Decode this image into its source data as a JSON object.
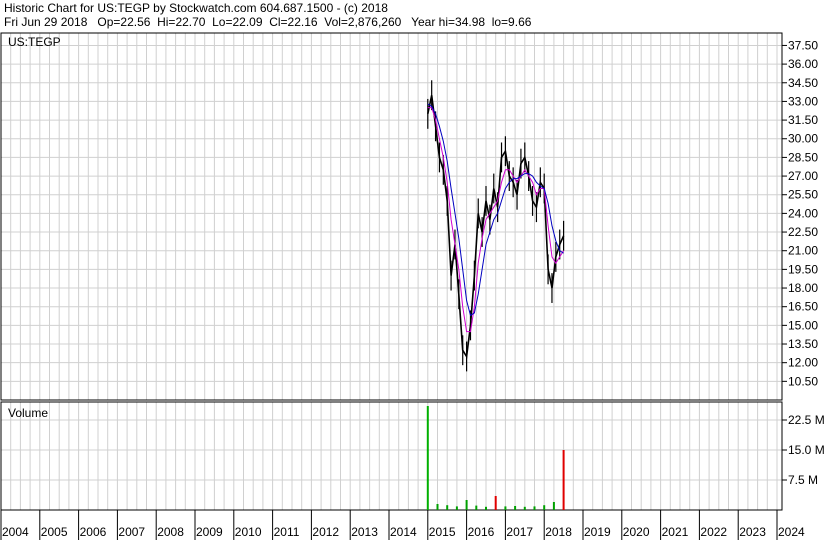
{
  "header": {
    "title_line": "Historic Chart for US:TEGP by Stockwatch.com 604.687.1500 - (c) 2018",
    "quote_line": "Fri Jun 29 2018   Op=22.56  Hi=22.70  Lo=22.09  Cl=22.16  Vol=2,876,260   Year hi=34.98  lo=9.66"
  },
  "price_panel": {
    "symbol_label": "US:TEGP"
  },
  "volume_panel": {
    "title": "Volume"
  },
  "chart_data": [
    {
      "type": "line",
      "title": "US:TEGP",
      "ylim": [
        9,
        38.5
      ],
      "yticks": [
        "37.50",
        "36.00",
        "34.50",
        "33.00",
        "31.50",
        "30.00",
        "28.50",
        "27.00",
        "25.50",
        "24.00",
        "22.50",
        "21.00",
        "19.50",
        "18.00",
        "16.50",
        "15.00",
        "13.50",
        "12.00",
        "10.50"
      ],
      "x": [
        "2015.0",
        "2015.1",
        "2015.2",
        "2015.3",
        "2015.4",
        "2015.5",
        "2015.6",
        "2015.7",
        "2015.8",
        "2015.9",
        "2016.0",
        "2016.1",
        "2016.2",
        "2016.3",
        "2016.4",
        "2016.5",
        "2016.6",
        "2016.7",
        "2016.8",
        "2016.9",
        "2017.0",
        "2017.1",
        "2017.2",
        "2017.3",
        "2017.4",
        "2017.5",
        "2017.6",
        "2017.7",
        "2017.8",
        "2017.9",
        "2018.0",
        "2018.1",
        "2018.2",
        "2018.3",
        "2018.4",
        "2018.5"
      ],
      "series": [
        {
          "values": [
            32.0,
            33.5,
            31.0,
            28.5,
            27.5,
            25.0,
            19.0,
            21.5,
            17.5,
            13.0,
            12.5,
            15.0,
            19.0,
            24.0,
            22.5,
            25.0,
            23.5,
            26.0,
            24.5,
            28.5,
            29.0,
            27.0,
            26.5,
            25.5,
            28.0,
            28.5,
            27.0,
            25.0,
            24.5,
            26.5,
            26.0,
            19.5,
            18.0,
            20.5,
            21.5,
            22.2
          ]
        },
        {
          "values": [
            32.5,
            32.5,
            31.5,
            30.0,
            28.5,
            26.5,
            23.5,
            21.5,
            19.5,
            16.5,
            14.5,
            14.5,
            16.5,
            20.0,
            22.0,
            23.5,
            24.0,
            24.5,
            25.0,
            26.5,
            27.5,
            27.5,
            27.0,
            26.5,
            27.0,
            27.5,
            27.0,
            26.5,
            25.5,
            26.0,
            26.0,
            23.0,
            20.5,
            20.0,
            20.5,
            21.0
          ]
        },
        {
          "values": [
            32.8,
            32.6,
            32.0,
            31.0,
            29.8,
            28.2,
            26.0,
            24.0,
            22.0,
            19.5,
            17.0,
            15.8,
            16.0,
            17.5,
            19.5,
            21.5,
            22.5,
            23.5,
            24.0,
            25.0,
            26.0,
            26.5,
            26.8,
            26.8,
            27.0,
            27.2,
            27.2,
            27.0,
            26.5,
            26.2,
            26.0,
            24.8,
            23.0,
            21.8,
            21.0,
            20.8
          ]
        }
      ]
    },
    {
      "type": "bar",
      "title": "Volume",
      "ylim": [
        0,
        27000000
      ],
      "yticks": [
        "22.5 M",
        "15.0 M",
        "7.5 M"
      ],
      "ytick_values": [
        22500000,
        15000000,
        7500000
      ],
      "x": [
        "2015.0",
        "2015.25",
        "2015.5",
        "2015.75",
        "2016.0",
        "2016.25",
        "2016.5",
        "2016.75",
        "2017.0",
        "2017.25",
        "2017.5",
        "2017.75",
        "2018.0",
        "2018.25",
        "2018.5"
      ],
      "series": [
        {
          "name": "Volume",
          "values": [
            26000000,
            1500000,
            1200000,
            900000,
            2500000,
            1100000,
            800000,
            3500000,
            900000,
            1000000,
            800000,
            900000,
            1200000,
            2000000,
            15000000
          ]
        }
      ],
      "x_tick_labels": [
        "2004",
        "2005",
        "2006",
        "2007",
        "2008",
        "2009",
        "2010",
        "2011",
        "2012",
        "2013",
        "2014",
        "2015",
        "2016",
        "2017",
        "2018",
        "2019",
        "2020",
        "2021",
        "2022",
        "2023",
        "2024"
      ]
    }
  ]
}
